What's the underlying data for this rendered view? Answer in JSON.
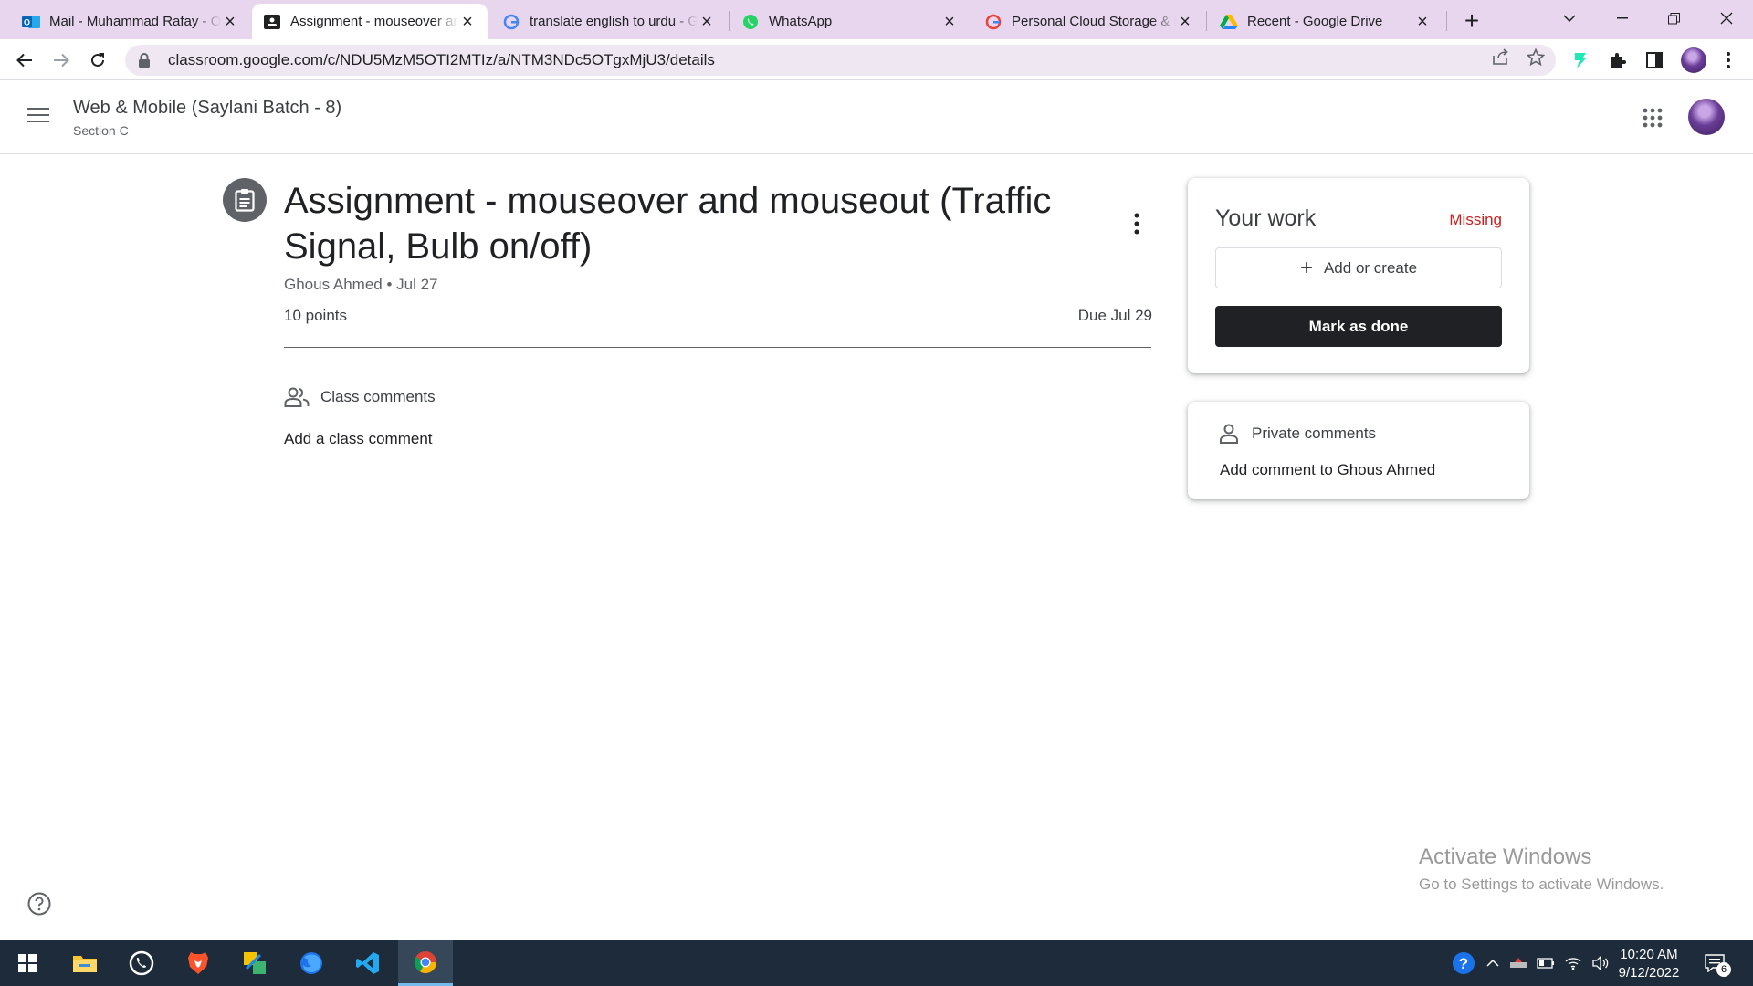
{
  "browser": {
    "tabs": [
      {
        "title": "Mail - Muhammad Rafay - Outlook",
        "icon": "outlook-icon"
      },
      {
        "title": "Assignment - mouseover and mouseout",
        "icon": "classroom-icon",
        "active": true
      },
      {
        "title": "translate english to urdu - Google Search",
        "icon": "google-icon"
      },
      {
        "title": "WhatsApp",
        "icon": "whatsapp-icon"
      },
      {
        "title": "Personal Cloud Storage & File Sharing",
        "icon": "google-icon"
      },
      {
        "title": "Recent - Google Drive",
        "icon": "google-drive-icon"
      }
    ],
    "url": "classroom.google.com/c/NDU5MzM5OTI2MTIz/a/NTM3NDc5OTgxMjU3/details"
  },
  "header": {
    "course_title": "Web & Mobile (Saylani Batch - 8)",
    "section": "Section C"
  },
  "assignment": {
    "title": "Assignment - mouseover and mouseout (Traffic Signal, Bulb on/off)",
    "author": "Ghous Ahmed",
    "date": "Jul 27",
    "meta_line": "Ghous Ahmed • Jul 27",
    "points": "10 points",
    "due": "Due Jul 29"
  },
  "class_comments": {
    "label": "Class comments",
    "add_label": "Add a class comment"
  },
  "your_work": {
    "title": "Your work",
    "status": "Missing",
    "add_label": "Add or create",
    "done_label": "Mark as done"
  },
  "private_comments": {
    "label": "Private comments",
    "add_label": "Add comment to Ghous Ahmed"
  },
  "watermark": {
    "line1": "Activate Windows",
    "line2": "Go to Settings to activate Windows."
  },
  "taskbar": {
    "time": "10:20 AM",
    "date": "9/12/2022",
    "notification_count": "6"
  },
  "colors": {
    "status_missing": "#c5221f",
    "primary_button": "#202124",
    "tabstrip": "#e8d5ee"
  }
}
